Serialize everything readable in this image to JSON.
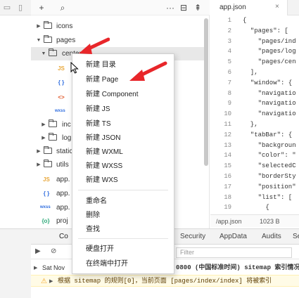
{
  "toolbar": {
    "add_glyph": "+",
    "search_glyph": "⌕",
    "more_glyph": "···",
    "split_glyph": "⊟",
    "collapse_glyph": "⇞"
  },
  "tree": {
    "items": [
      {
        "label": "icons",
        "expanded": false
      },
      {
        "label": "pages",
        "expanded": true
      },
      {
        "label": "center",
        "expanded": true
      },
      {
        "label": "JS"
      },
      {
        "label": "{ }"
      },
      {
        "label": "<>"
      },
      {
        "label": "wxss"
      },
      {
        "label": "inc",
        "expanded": false
      },
      {
        "label": "log",
        "expanded": false
      },
      {
        "label": "static",
        "expanded": false
      },
      {
        "label": "utils",
        "expanded": false
      },
      {
        "label": "app."
      },
      {
        "label": "app."
      },
      {
        "label": "app."
      },
      {
        "label": "proj"
      }
    ],
    "file_badges": {
      "js": "JS",
      "json": "{ }",
      "wxml": "<>",
      "wxss": "wxss",
      "proj": "{o}"
    }
  },
  "editor": {
    "tab_label": "app.json",
    "close_glyph": "×",
    "line_numbers": [
      "1",
      "2",
      "3",
      "4",
      "5",
      "6",
      "7",
      "8",
      "9",
      "10",
      "11",
      "12",
      "13",
      "14",
      "15",
      "16",
      "17",
      "18",
      "19"
    ],
    "lines": [
      "{",
      "  \"pages\": [",
      "    \"pages/ind",
      "    \"pages/log",
      "    \"pages/cen",
      "  ],",
      "  \"window\": {",
      "    \"navigatio",
      "    \"navigatio",
      "    \"navigatio",
      "  },",
      "  \"tabBar\": {",
      "    \"backgroun",
      "    \"color\": \"",
      "    \"selectedC",
      "    \"borderSty",
      "    \"position\"",
      "    \"list\": [",
      "      {"
    ],
    "status_path": "/app.json",
    "status_size": "1023 B"
  },
  "context_menu": {
    "items": [
      "新建 目录",
      "新建 Page",
      "新建 Component",
      "新建 JS",
      "新建 TS",
      "新建 JSON",
      "新建 WXML",
      "新建 WXSS",
      "新建 WXS",
      "重命名",
      "删除",
      "查找",
      "硬盘打开",
      "在终端中打开"
    ]
  },
  "console": {
    "tabs": [
      "Co",
      "rk",
      "Security",
      "AppData",
      "Audits",
      "Se"
    ],
    "filter_placeholder": "Filter",
    "log_prefix": "Sat Nov",
    "log_text": "0800 (中国标准时间) sitemap 索引情况提",
    "warn_text": "根据 sitemap 的规则[0]，当前页面 [pages/index/index] 将被索引"
  },
  "colors": {
    "menu_arrow": "#e8262a",
    "warning_bg": "#fffbe6",
    "warning_icon": "#f5a623",
    "folder_json": "#e8a73a",
    "wxss_badge": "#2d6cdf"
  }
}
